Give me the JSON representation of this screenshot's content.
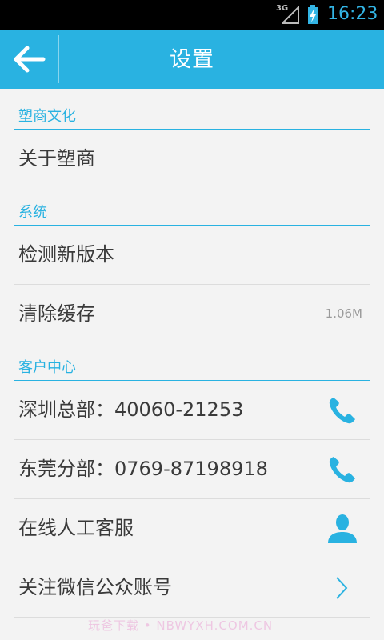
{
  "status_bar": {
    "network": "3G",
    "time": "16:23"
  },
  "header": {
    "title": "设置",
    "back_icon": "arrow-left-icon"
  },
  "sections": [
    {
      "title": "塑商文化",
      "rows": [
        {
          "label": "关于塑商"
        }
      ]
    },
    {
      "title": "系统",
      "rows": [
        {
          "label": "检测新版本"
        },
        {
          "label": "清除缓存",
          "value": "1.06M"
        }
      ]
    },
    {
      "title": "客户中心",
      "rows": [
        {
          "label": "深圳总部：40060-21253",
          "icon": "phone-icon"
        },
        {
          "label": "东莞分部：0769-87198918",
          "icon": "phone-icon"
        },
        {
          "label": "在线人工客服",
          "icon": "person-icon"
        },
        {
          "label": "关注微信公众账号",
          "icon": "chevron-right-icon"
        }
      ]
    }
  ],
  "watermark": "玩爸下载 • NBWYXH.COM.CN",
  "accent_color": "#29b2e1"
}
